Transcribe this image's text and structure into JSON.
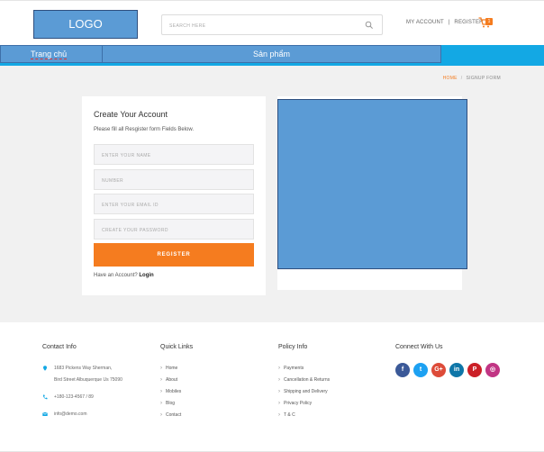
{
  "header": {
    "logo_text": "LOGO",
    "search_placeholder": "SEARCH HERE",
    "my_account": "MY ACCOUNT",
    "account_separator": "|",
    "register": "REGISTER",
    "cart_count": "1"
  },
  "nav": {
    "home": "Trang chủ",
    "products": "Sản phẩm"
  },
  "breadcrumb": {
    "home": "HOME",
    "separator": "/",
    "current": "SIGNUP FORM"
  },
  "form": {
    "title": "Create Your Account",
    "subtitle": "Please fill all Resgister form Fields Below.",
    "name_placeholder": "ENTER YOUR NAME",
    "number_placeholder": "NUMBER",
    "email_placeholder": "ENTER YOUR EMAIL ID",
    "password_placeholder": "CREATE YOUR PASSWORD",
    "register_label": "REGISTER",
    "have_account": "Have an Account?",
    "login_label": "Login"
  },
  "footer": {
    "contact": {
      "title": "Contact Info",
      "address_line1": "1683 Pickens Way Sherman,",
      "address_line2": "Bird Street Albuquerque Us 75090",
      "phone": "+180-123-4567 / 89",
      "email": "info@demo.com"
    },
    "quick_links": {
      "title": "Quick Links",
      "items": [
        "Home",
        "About",
        "Mobiles",
        "Blog",
        "Contact"
      ]
    },
    "policy": {
      "title": "Policy Info",
      "items": [
        "Payments",
        "Cancellation & Returns",
        "Shipping and Delivery",
        "Privacy Policy",
        "T & C"
      ]
    },
    "connect": {
      "title": "Connect With Us",
      "socials": [
        {
          "name": "facebook-icon",
          "glyph": "f",
          "color": "#3b5998"
        },
        {
          "name": "twitter-icon",
          "glyph": "t",
          "color": "#1da1f2"
        },
        {
          "name": "google-plus-icon",
          "glyph": "G+",
          "color": "#dd4b39"
        },
        {
          "name": "linkedin-icon",
          "glyph": "in",
          "color": "#0e76a8"
        },
        {
          "name": "pinterest-icon",
          "glyph": "P",
          "color": "#cb2027"
        },
        {
          "name": "instagram-icon",
          "glyph": "◎",
          "color": "#c13584"
        }
      ]
    }
  },
  "colors": {
    "accent": "#f57c1f",
    "nav_bar": "#13a8e4",
    "placeholder_block": "#5b9bd5"
  }
}
